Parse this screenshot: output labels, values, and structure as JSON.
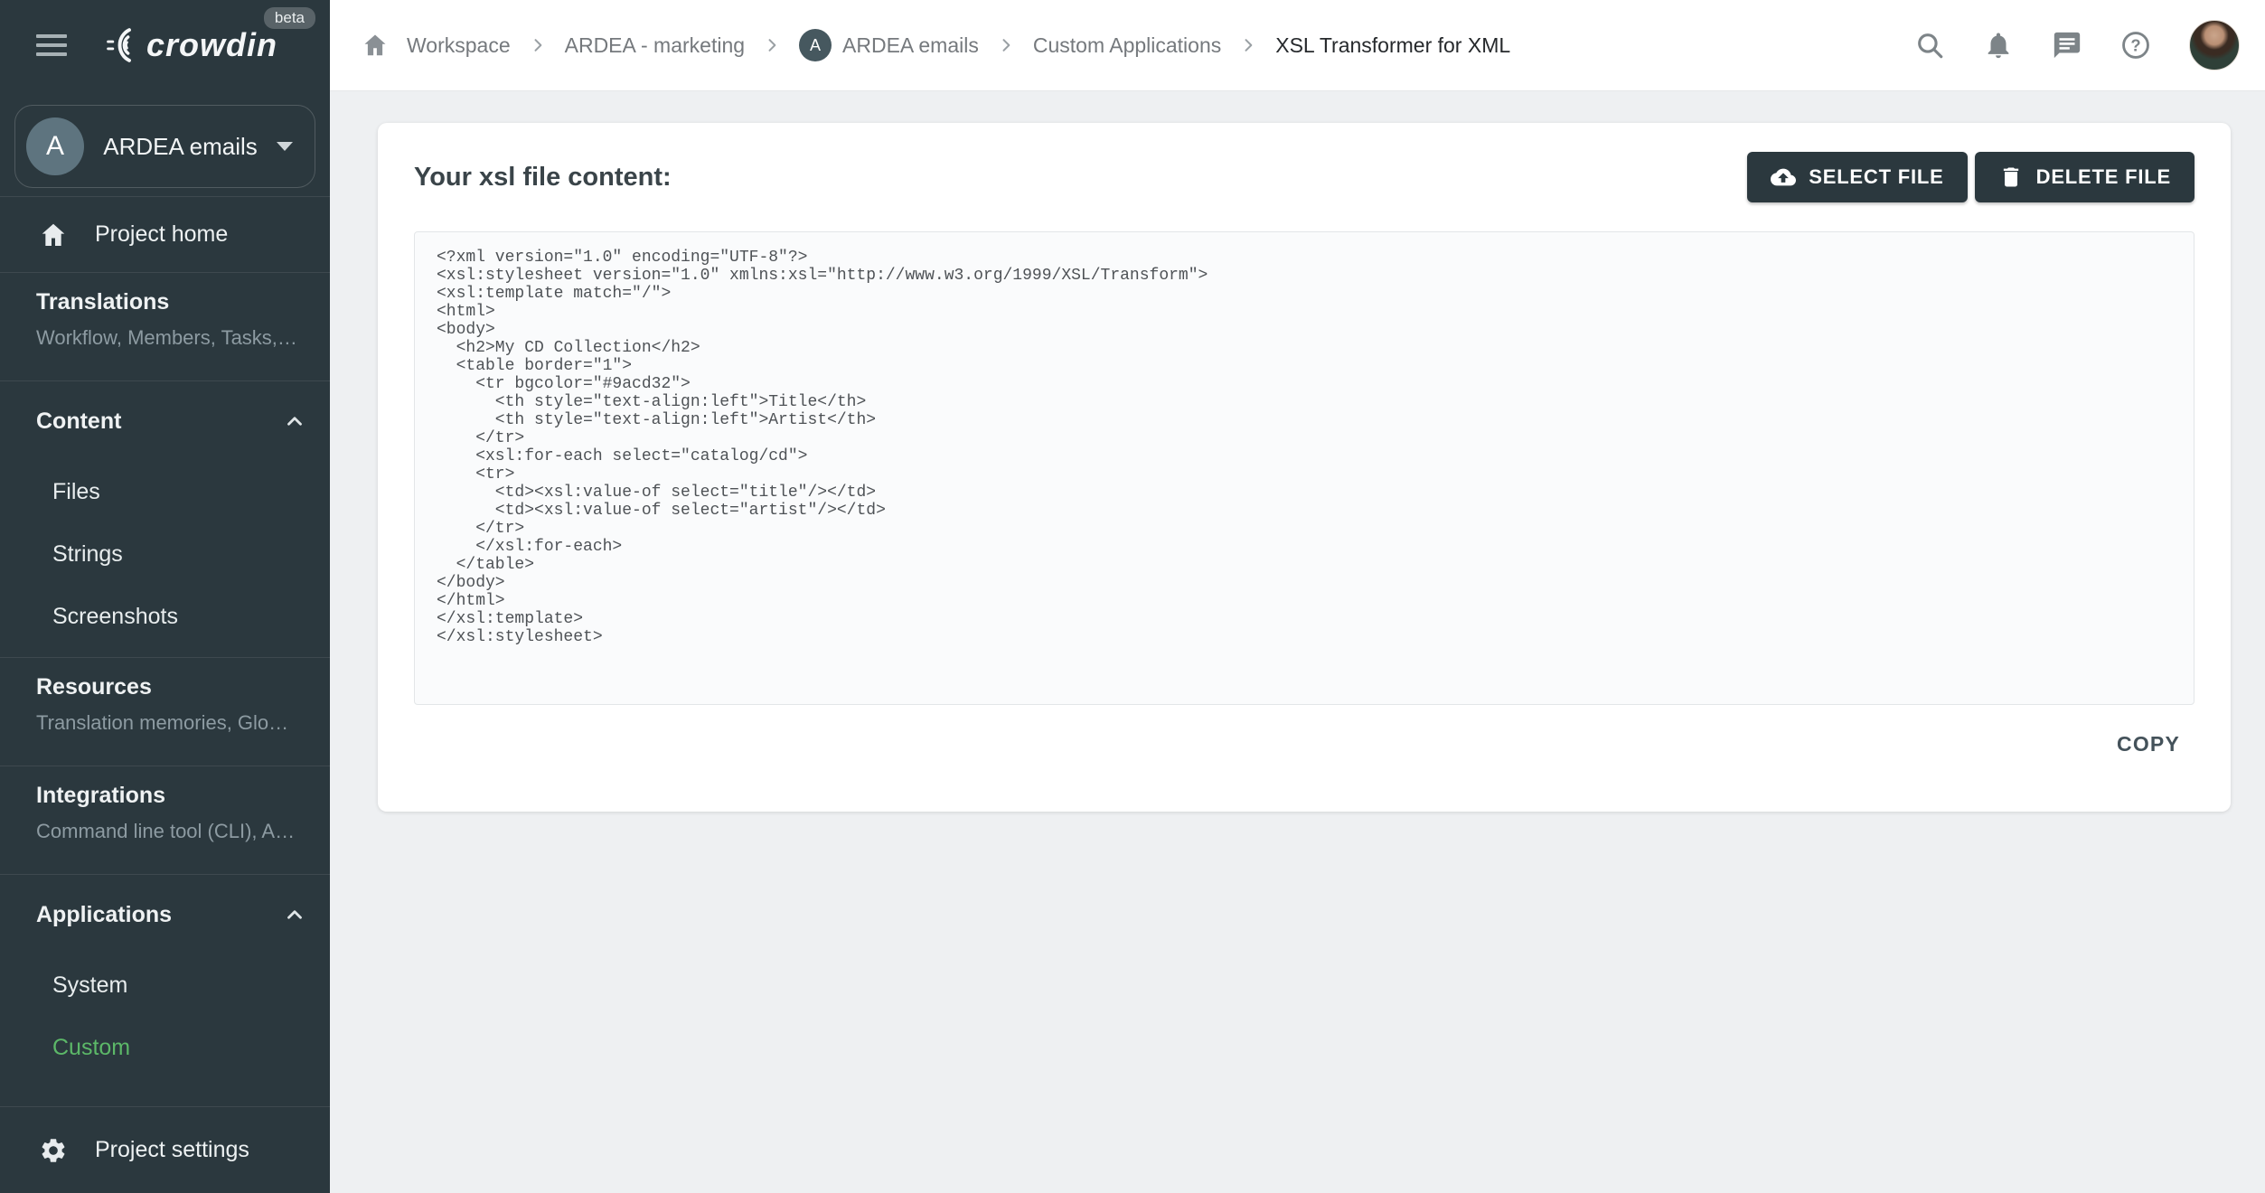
{
  "app": {
    "logo_text": "crowdin",
    "beta_badge": "beta"
  },
  "sidebar": {
    "project": {
      "initial": "A",
      "name": "ARDEA emails"
    },
    "project_home": "Project home",
    "project_settings": "Project settings",
    "sections": [
      {
        "title": "Translations",
        "subtitle": "Workflow, Members, Tasks, Act…"
      },
      {
        "title": "Content",
        "children": [
          "Files",
          "Strings",
          "Screenshots"
        ]
      },
      {
        "title": "Resources",
        "subtitle": "Translation memories, Glossari…"
      },
      {
        "title": "Integrations",
        "subtitle": "Command line tool (CLI), API, A…"
      },
      {
        "title": "Applications",
        "children": [
          "System",
          "Custom"
        ],
        "active_child": "Custom"
      }
    ]
  },
  "breadcrumb": {
    "project_initial": "A",
    "items": [
      "Workspace",
      "ARDEA - marketing",
      "ARDEA emails",
      "Custom Applications",
      "XSL Transformer for XML"
    ]
  },
  "main": {
    "heading": "Your xsl file content:",
    "buttons": {
      "select": "SELECT FILE",
      "delete": "DELETE FILE",
      "copy": "COPY"
    },
    "code": "<?xml version=\"1.0\" encoding=\"UTF-8\"?>\n<xsl:stylesheet version=\"1.0\" xmlns:xsl=\"http://www.w3.org/1999/XSL/Transform\">\n<xsl:template match=\"/\">\n<html>\n<body>\n  <h2>My CD Collection</h2>\n  <table border=\"1\">\n    <tr bgcolor=\"#9acd32\">\n      <th style=\"text-align:left\">Title</th>\n      <th style=\"text-align:left\">Artist</th>\n    </tr>\n    <xsl:for-each select=\"catalog/cd\">\n    <tr>\n      <td><xsl:value-of select=\"title\"/></td>\n      <td><xsl:value-of select=\"artist\"/></td>\n    </tr>\n    </xsl:for-each>\n  </table>\n</body>\n</html>\n</xsl:template>\n</xsl:stylesheet>"
  },
  "colors": {
    "sidebar_bg": "#2b383e",
    "accent_green": "#5cb868",
    "button_bg": "#2b383e",
    "page_bg": "#eef0f2",
    "card_bg": "#ffffff"
  }
}
